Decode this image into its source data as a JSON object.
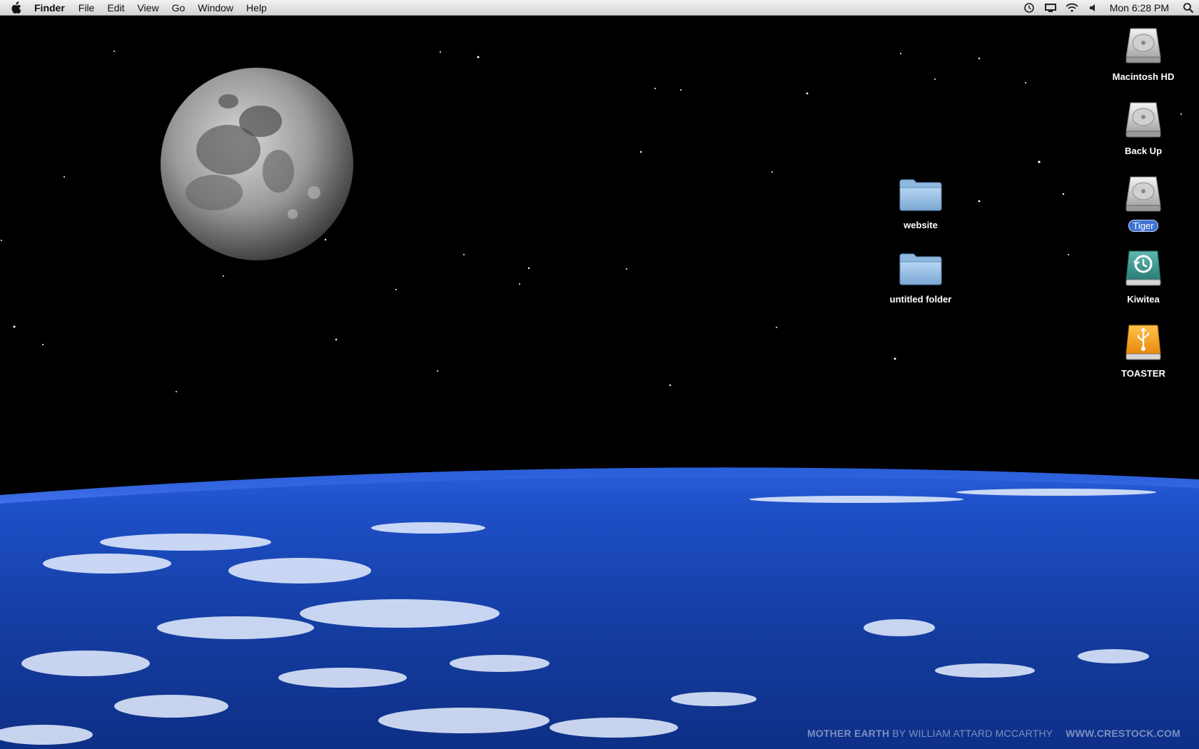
{
  "menubar": {
    "app_name": "Finder",
    "items": [
      "File",
      "Edit",
      "View",
      "Go",
      "Window",
      "Help"
    ],
    "clock": "Mon 6:28 PM"
  },
  "desktop": {
    "icons": [
      {
        "label": "Macintosh HD",
        "icon": "hard-drive-icon"
      },
      {
        "label": "Back Up",
        "icon": "hard-drive-icon"
      },
      {
        "label": "Tiger",
        "icon": "hard-drive-icon",
        "selected": true
      },
      {
        "label": "Kiwitea",
        "icon": "time-machine-drive-icon"
      },
      {
        "label": "TOASTER",
        "icon": "usb-drive-icon"
      },
      {
        "label": "website",
        "icon": "folder-icon"
      },
      {
        "label": "untitled folder",
        "icon": "folder-icon"
      }
    ]
  },
  "wallpaper": {
    "credit_title": "MOTHER EARTH",
    "credit_author": "BY WILLIAM ATTARD MCCARTHY",
    "credit_site": "WWW.CRESTOCK.COM"
  },
  "colors": {
    "selection": "#3f72d4",
    "folder": "#8fb8e0",
    "usb_drive": "#f5a623",
    "earth_blue": "#1d4fc7"
  }
}
